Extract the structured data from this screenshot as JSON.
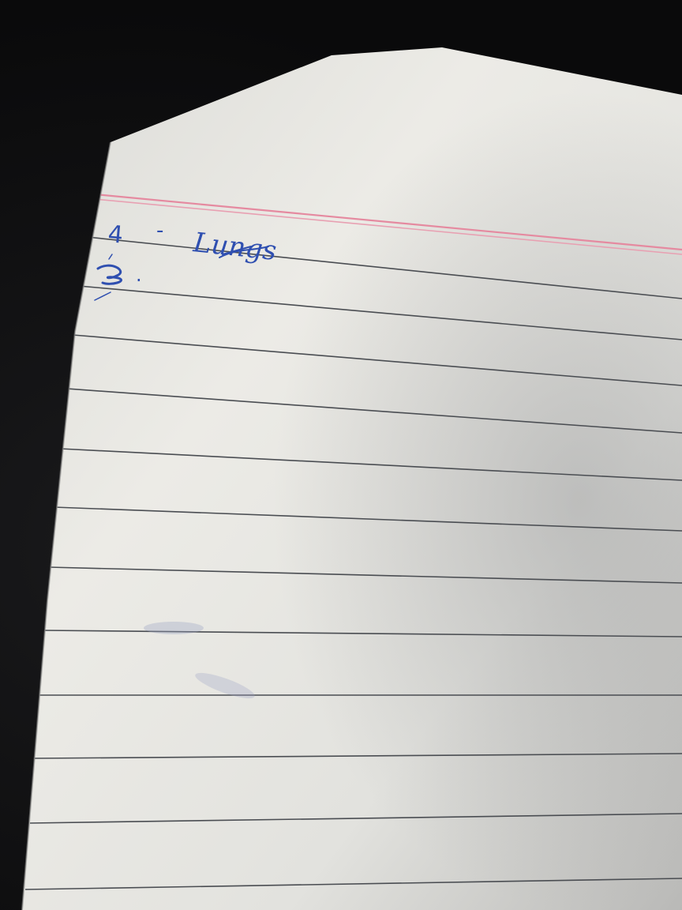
{
  "scene": {
    "description_free": true,
    "colors": {
      "background": "#0d0d0e",
      "paper": "#e9e8e2",
      "paper_shadow": "#c9c9c6",
      "rule_line": "#4a4d52",
      "margin_line": "#e58aa0",
      "ink": "#2f4fb0"
    }
  },
  "notebook": {
    "ruled_lines": 13,
    "margin_lines": 2
  },
  "handwriting": {
    "line1_number": "4",
    "line1_dash": "-",
    "line1_word": "Lungs",
    "line2_mark": "."
  }
}
